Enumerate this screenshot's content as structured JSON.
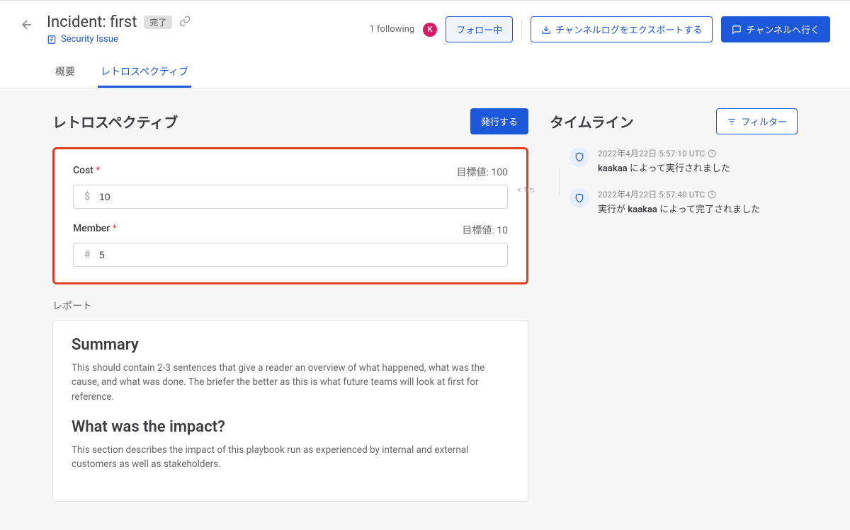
{
  "header": {
    "title": "Incident: first",
    "status": "完了",
    "category": "Security Issue",
    "following": "1 following",
    "avatar_letter": "K",
    "follow_btn": "フォロー中",
    "export_btn": "チャンネルログをエクスポートする",
    "channel_btn": "チャンネルへ行く"
  },
  "tabs": {
    "overview": "概要",
    "retro": "レトロスペクティブ"
  },
  "retro": {
    "title": "レトロスペクティブ",
    "publish_btn": "発行する",
    "target_prefix": "目標値: ",
    "fields": [
      {
        "label": "Cost",
        "required": true,
        "target": "100",
        "prefix": "$",
        "value": "10"
      },
      {
        "label": "Member",
        "required": true,
        "target": "10",
        "prefix": "#",
        "value": "5"
      }
    ],
    "report_label": "レポート",
    "report": {
      "summary_title": "Summary",
      "summary_text": "This should contain 2-3 sentences that give a reader an overview of what happened, what was the cause, and what was done. The briefer the better as this is what future teams will look at first for reference.",
      "impact_title": "What was the impact?",
      "impact_text": "This section describes the impact of this playbook run as experienced by internal and external customers as well as stakeholders."
    }
  },
  "timeline": {
    "title": "タイムライン",
    "filter_btn": "フィルター",
    "duration": "< 1m",
    "items": [
      {
        "time": "2022年4月22日 5:57:10 UTC",
        "html_pre": "",
        "strong": "kaakaa",
        "html_post": " によって実行されました"
      },
      {
        "time": "2022年4月22日 5:57:40 UTC",
        "html_pre": "実行が ",
        "strong": "kaakaa",
        "html_post": " によって完了されました"
      }
    ]
  }
}
